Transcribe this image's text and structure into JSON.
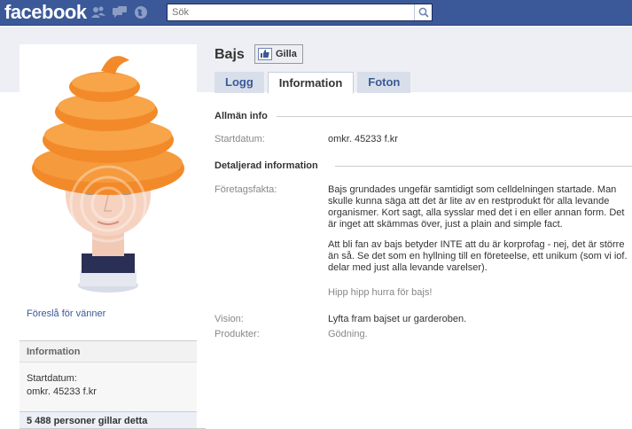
{
  "topbar": {
    "logo": "facebook",
    "search_placeholder": "Sök"
  },
  "sidebar": {
    "suggest_friends": "Föreslå för vänner",
    "info_header": "Information",
    "start_label": "Startdatum:",
    "start_value": "omkr. 45233 f.kr",
    "likes_count": "5 488 personer gillar detta"
  },
  "page": {
    "name": "Bajs",
    "like_button": "Gilla"
  },
  "tabs": [
    {
      "label": "Logg"
    },
    {
      "label": "Information"
    },
    {
      "label": "Foton"
    }
  ],
  "general": {
    "title": "Allmän info",
    "start_label": "Startdatum:",
    "start_value": "omkr. 45233 f.kr"
  },
  "detailed": {
    "title": "Detaljerad information",
    "facts_label": "Företagsfakta:",
    "facts_p1": "Bajs grundades ungefär samtidigt som celldelningen startade. Man skulle kunna säga att det är lite av en restprodukt för alla levande organismer. Kort sagt, alla sysslar med det i en eller annan form. Det är inget att skämmas över, just a plain and simple fact.",
    "facts_p2": "Att bli fan av bajs betyder INTE att du är korprofag - nej, det är större än så. Se det som en hyllning till en företeelse, ett unikum (som vi iof. delar med just alla levande varelser).",
    "facts_p3": "Hipp hipp hurra för bajs!",
    "vision_label": "Vision:",
    "vision_value": "Lyfta fram bajset ur garderoben.",
    "products_label": "Produkter:",
    "products_value": "Gödning."
  },
  "colors": {
    "brand": "#3b5998",
    "tab_bg": "#d8dfea",
    "band": "#edeff4",
    "hat_orange": "#f28a2a"
  }
}
